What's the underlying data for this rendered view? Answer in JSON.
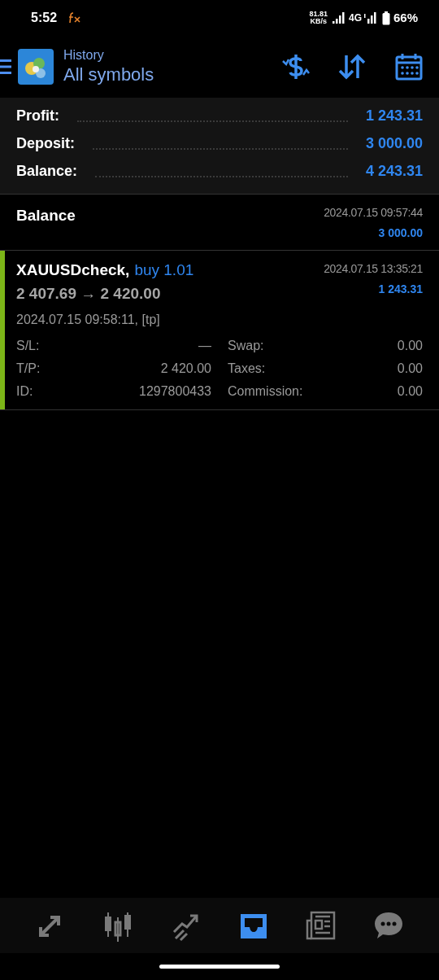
{
  "status_bar": {
    "time": "5:52",
    "speed_value": "81.81",
    "speed_unit": "KB/s",
    "network": "4G",
    "battery": "66%"
  },
  "header": {
    "subtitle": "History",
    "title": "All symbols"
  },
  "summary": [
    {
      "label": "Profit:",
      "value": "1 243.31"
    },
    {
      "label": "Deposit:",
      "value": "3 000.00"
    },
    {
      "label": "Balance:",
      "value": "4 243.31"
    }
  ],
  "deals": [
    {
      "kind": "balance",
      "title": "Balance",
      "time": "2024.07.15 09:57:44",
      "amount": "3 000.00"
    },
    {
      "kind": "trade",
      "symbol": "XAUUSDcheck,",
      "side": "buy 1.01",
      "prices": "2 407.69 → 2 420.00",
      "time": "2024.07.15 13:35:21",
      "amount": "1 243.31",
      "open_info": "2024.07.15 09:58:11, [tp]",
      "color": "#7cb518",
      "fields": [
        {
          "label": "S/L:",
          "value": "—"
        },
        {
          "label": "Swap:",
          "value": "0.00"
        },
        {
          "label": "T/P:",
          "value": "2 420.00"
        },
        {
          "label": "Taxes:",
          "value": "0.00"
        },
        {
          "label": "ID:",
          "value": "1297800433"
        },
        {
          "label": "Commission:",
          "value": "0.00"
        }
      ]
    }
  ],
  "nav": [
    {
      "kind": "trade",
      "selected": false
    },
    {
      "kind": "chart",
      "selected": false
    },
    {
      "kind": "signals",
      "selected": false
    },
    {
      "kind": "history",
      "selected": true
    },
    {
      "kind": "news",
      "selected": false
    },
    {
      "kind": "chat",
      "selected": false
    }
  ]
}
